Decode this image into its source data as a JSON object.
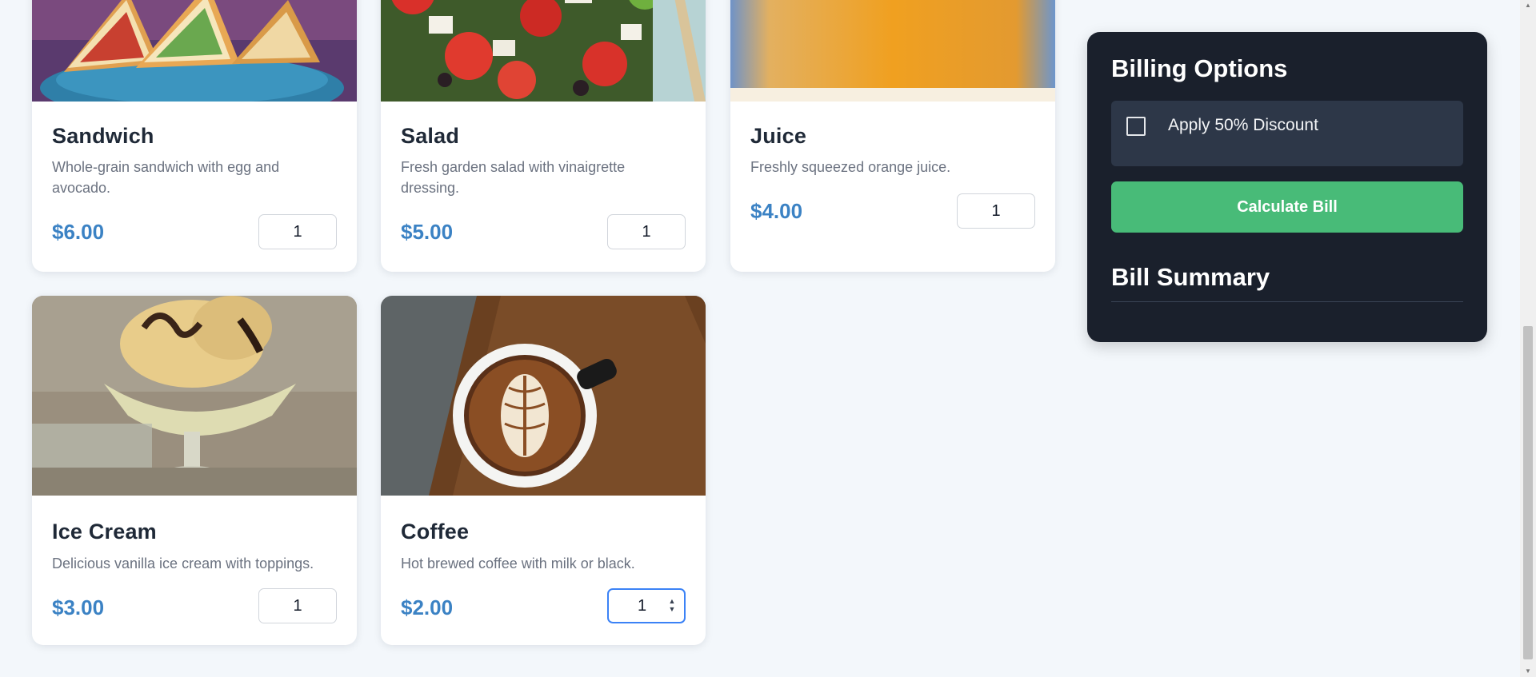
{
  "products": [
    {
      "name": "Sandwich",
      "description": "Whole-grain sandwich with egg and avocado.",
      "price": "$6.00",
      "quantity": "1"
    },
    {
      "name": "Salad",
      "description": "Fresh garden salad with vinaigrette dressing.",
      "price": "$5.00",
      "quantity": "1"
    },
    {
      "name": "Juice",
      "description": "Freshly squeezed orange juice.",
      "price": "$4.00",
      "quantity": "1"
    },
    {
      "name": "Ice Cream",
      "description": "Delicious vanilla ice cream with toppings.",
      "price": "$3.00",
      "quantity": "1"
    },
    {
      "name": "Coffee",
      "description": "Hot brewed coffee with milk or black.",
      "price": "$2.00",
      "quantity": "1"
    }
  ],
  "billing": {
    "title": "Billing Options",
    "discount_label": "Apply 50% Discount",
    "discount_checked": false,
    "calculate_label": "Calculate Bill",
    "summary_title": "Bill Summary"
  },
  "colors": {
    "page_bg": "#f3f7fb",
    "panel_bg": "#1a202c",
    "panel_box": "#2d3748",
    "accent_green": "#48bb78",
    "price_blue": "#3b82c4"
  },
  "icons": {
    "spinner": "number-spinner-icon",
    "scroll_up": "scroll-up-arrow-icon",
    "scroll_down": "scroll-down-arrow-icon"
  }
}
